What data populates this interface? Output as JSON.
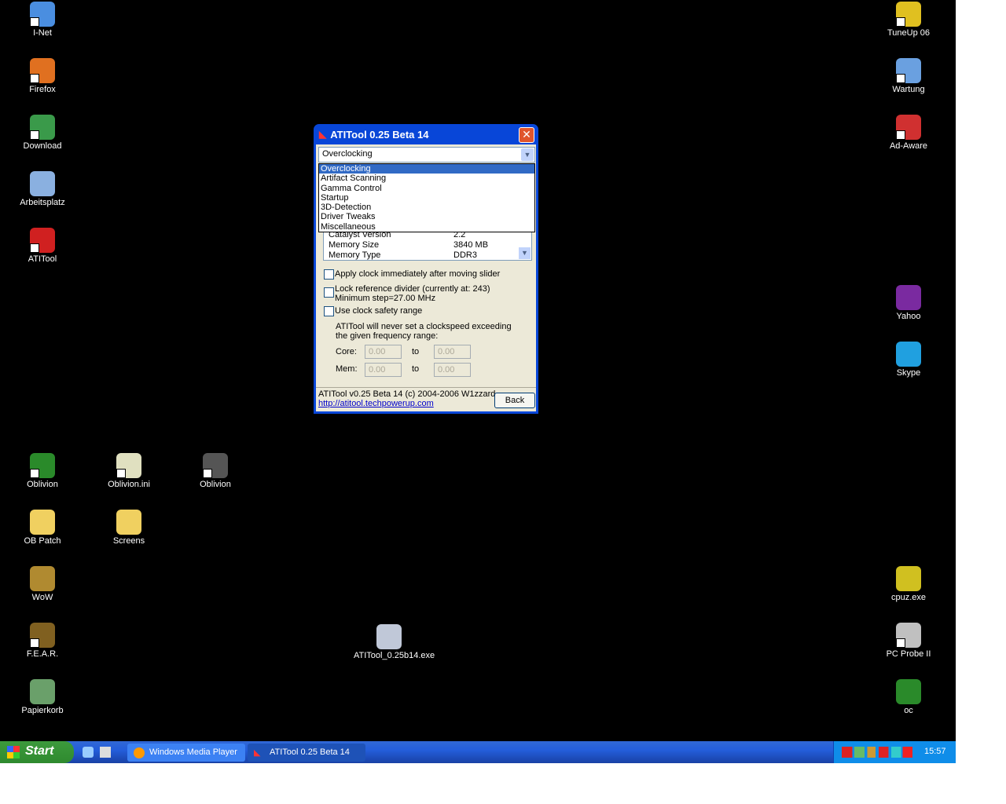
{
  "desktop": {
    "left_icons": [
      {
        "label": "I-Net",
        "color": "#4a8ee0"
      },
      {
        "label": "Firefox",
        "color": "#e07020"
      },
      {
        "label": "Download",
        "color": "#3a9a4a"
      },
      {
        "label": "Arbeitsplatz",
        "color": "#8ab0e0"
      },
      {
        "label": "ATITool",
        "color": "#d02020"
      },
      {
        "label": "Oblivion",
        "color": "#2a8a2a"
      },
      {
        "label": "Oblivion.ini",
        "color": "#e0e0c0"
      },
      {
        "label": "Oblivion",
        "color": "#555"
      },
      {
        "label": "OB Patch",
        "color": "#f0d060"
      },
      {
        "label": "Screens",
        "color": "#f0d060"
      },
      {
        "label": "WoW",
        "color": "#b08a30"
      },
      {
        "label": "F.E.A.R.",
        "color": "#806020"
      },
      {
        "label": "Papierkorb",
        "color": "#6aa06a"
      },
      {
        "label": "ATITool_0.25b14.exe",
        "color": "#c0c8d8"
      }
    ],
    "right_icons": [
      {
        "label": "TuneUp 06",
        "color": "#e0c020"
      },
      {
        "label": "Wartung",
        "color": "#6aa0e0"
      },
      {
        "label": "Ad-Aware",
        "color": "#d03030"
      },
      {
        "label": "Yahoo",
        "color": "#7a2aa0"
      },
      {
        "label": "Skype",
        "color": "#20a0e0"
      },
      {
        "label": "cpuz.exe",
        "color": "#d0c020"
      },
      {
        "label": "PC Probe II",
        "color": "#c0c0c0"
      },
      {
        "label": "oc",
        "color": "#2a8a2a"
      }
    ]
  },
  "dialog": {
    "title": "ATITool 0.25 Beta 14",
    "combo_value": "Overclocking",
    "options": [
      "Overclocking",
      "Artifact Scanning",
      "Gamma Control",
      "Startup",
      "3D-Detection",
      "Driver Tweaks",
      "Miscellaneous"
    ],
    "info_rows": [
      [
        "Catalyst Version",
        "2.2"
      ],
      [
        "Memory Size",
        "3840 MB"
      ],
      [
        "Memory Type",
        "DDR3"
      ]
    ],
    "chk_apply": "Apply clock immediately after moving slider",
    "chk_lock": "Lock reference divider (currently at: 243)",
    "chk_lock2": "Minimum step=27.00 MHz",
    "chk_safety": "Use clock safety range",
    "safety_desc1": "ATITool will never set a clockspeed exceeding",
    "safety_desc2": "the given frequency range:",
    "core_label": "Core:",
    "mem_label": "Mem:",
    "to": "to",
    "core_min": "0.00",
    "core_max": "0.00",
    "mem_min": "0.00",
    "mem_max": "0.00",
    "footer_text": "ATITool v0.25 Beta 14 (c) 2004-2006 W1zzard",
    "footer_link": "http://atitool.techpowerup.com",
    "back": "Back"
  },
  "taskbar": {
    "start": "Start",
    "tasks": [
      "Windows Media Player",
      "ATITool 0.25 Beta 14"
    ],
    "clock": "15:57"
  }
}
